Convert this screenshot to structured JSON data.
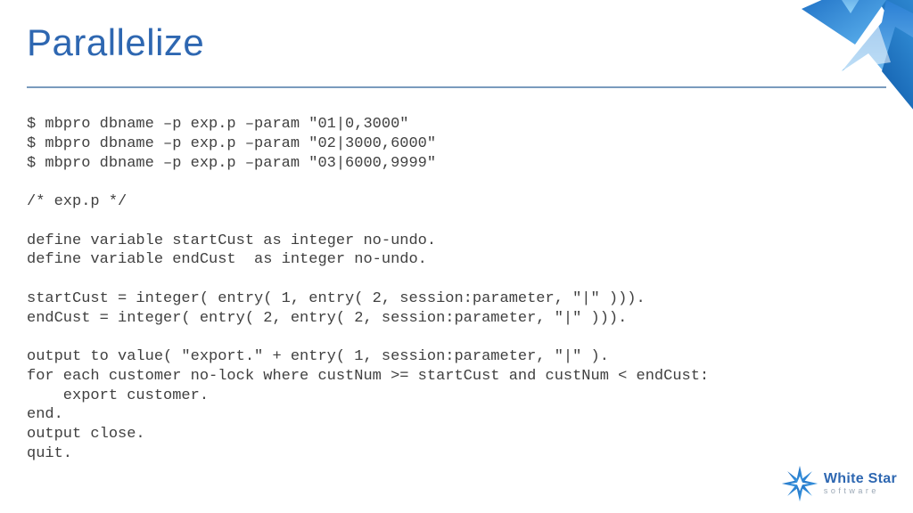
{
  "title": "Parallelize",
  "code": "$ mbpro dbname –p exp.p –param \"01|0,3000\"\n$ mbpro dbname –p exp.p –param \"02|3000,6000\"\n$ mbpro dbname –p exp.p –param \"03|6000,9999\"\n\n/* exp.p */\n\ndefine variable startCust as integer no-undo.\ndefine variable endCust  as integer no-undo.\n\nstartCust = integer( entry( 1, entry( 2, session:parameter, \"|\" ))).\nendCust = integer( entry( 2, entry( 2, session:parameter, \"|\" ))).\n\noutput to value( \"export.\" + entry( 1, session:parameter, \"|\" ).\nfor each customer no-lock where custNum >= startCust and custNum < endCust:\n    export customer.\nend.\noutput close.\nquit.",
  "logo": {
    "name": "White Star",
    "sub": "software"
  }
}
